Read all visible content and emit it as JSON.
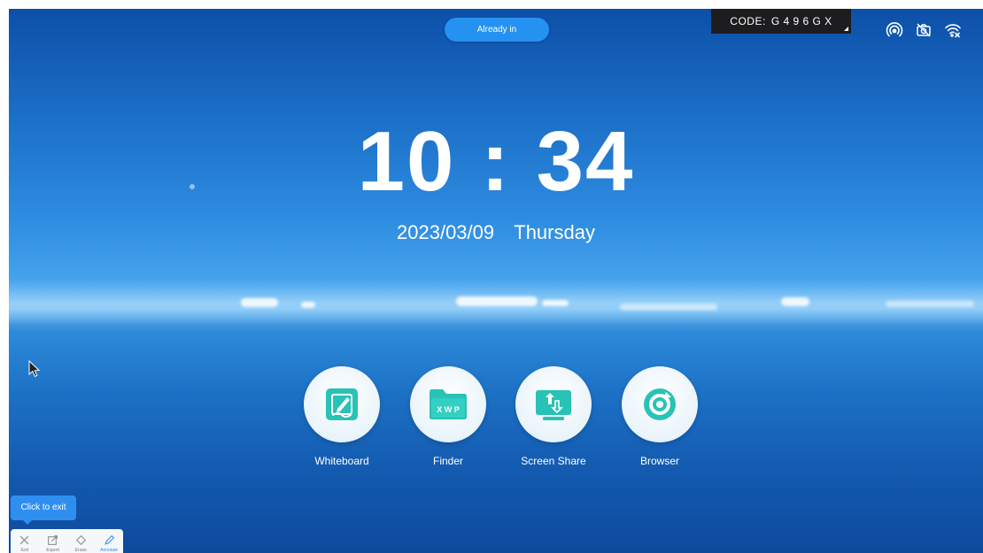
{
  "top": {
    "status_button": "Already in",
    "code_label": "CODE:",
    "code_value": "G 4 9 6 G X"
  },
  "status_icons": [
    "hotspot-icon",
    "camera-off-icon",
    "wifi-disconnected-icon"
  ],
  "clock": {
    "time": "10 : 34",
    "date": "2023/03/09",
    "weekday": "Thursday"
  },
  "apps": [
    {
      "label": "Whiteboard",
      "icon": "whiteboard-pen-icon"
    },
    {
      "label": "Finder",
      "icon": "folder-icon",
      "icon_text": "X W P"
    },
    {
      "label": "Screen Share",
      "icon": "screen-share-icon"
    },
    {
      "label": "Browser",
      "icon": "browser-icon"
    }
  ],
  "annotation": {
    "tooltip": "Click to exit",
    "tools": [
      "Exit",
      "Export",
      "Erase",
      "Annotate"
    ],
    "active_tool": "Annotate"
  },
  "colors": {
    "accent": "#2592f2",
    "app_icon": "#28c2b6",
    "code_bg": "#1d1d1f"
  }
}
